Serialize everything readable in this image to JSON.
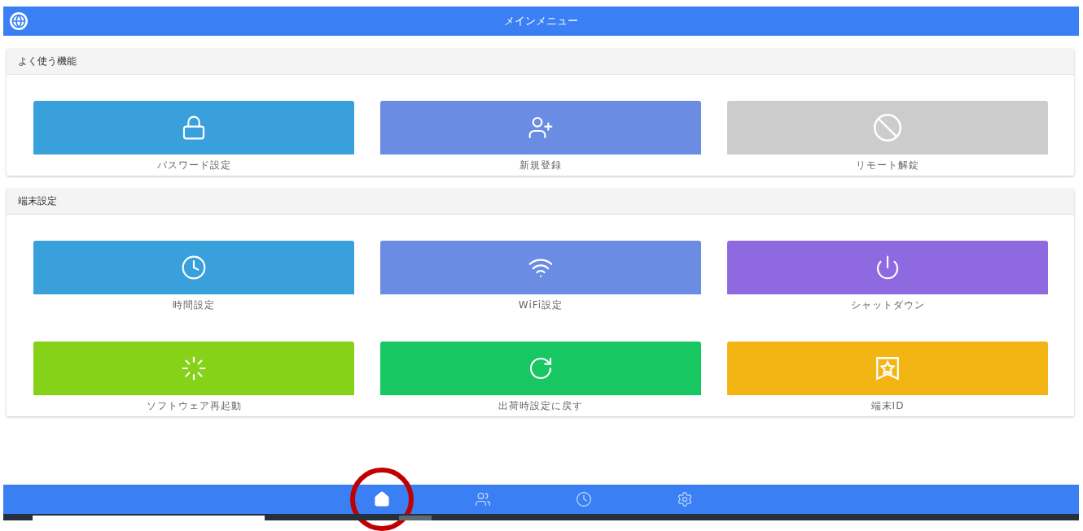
{
  "header": {
    "title": "メインメニュー"
  },
  "sections": [
    {
      "title": "よく使う機能",
      "tiles": [
        {
          "label": "パスワード設定",
          "kind": "lock",
          "color": "#3aa0dc"
        },
        {
          "label": "新規登録",
          "kind": "user-plus",
          "color": "#6a8ce2"
        },
        {
          "label": "リモート解錠",
          "kind": "ban",
          "color": "#cccccc"
        }
      ]
    },
    {
      "title": "端末設定",
      "tiles": [
        {
          "label": "時間設定",
          "kind": "clock",
          "color": "#3aa0dc"
        },
        {
          "label": "WiFi設定",
          "kind": "wifi",
          "color": "#6a8ce2"
        },
        {
          "label": "シャットダウン",
          "kind": "power",
          "color": "#8e69e0"
        },
        {
          "label": "ソフトウェア再起動",
          "kind": "loader",
          "color": "#86d219"
        },
        {
          "label": "出荷時設定に戻す",
          "kind": "rotate",
          "color": "#18c762"
        },
        {
          "label": "端末ID",
          "kind": "star-frame",
          "color": "#f3b514"
        }
      ]
    }
  ],
  "bottom_nav": [
    {
      "kind": "home",
      "selected": true,
      "circled": true
    },
    {
      "kind": "users",
      "selected": false,
      "circled": false
    },
    {
      "kind": "clock",
      "selected": false,
      "circled": false
    },
    {
      "kind": "settings",
      "selected": false,
      "circled": false
    }
  ]
}
